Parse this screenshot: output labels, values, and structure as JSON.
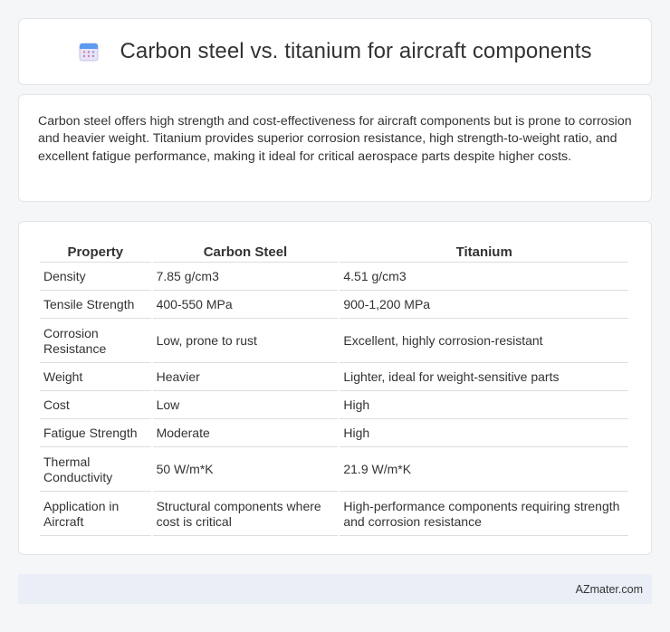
{
  "header": {
    "title": "Carbon steel vs. titanium for aircraft components",
    "icon": "calendar-icon"
  },
  "summary": {
    "text": "Carbon steel offers high strength and cost-effectiveness for aircraft components but is prone to corrosion and heavier weight. Titanium provides superior corrosion resistance, high strength-to-weight ratio, and excellent fatigue performance, making it ideal for critical aerospace parts despite higher costs."
  },
  "table": {
    "headers": [
      "Property",
      "Carbon Steel",
      "Titanium"
    ],
    "rows": [
      [
        "Density",
        "7.85 g/cm3",
        "4.51 g/cm3"
      ],
      [
        "Tensile Strength",
        "400-550 MPa",
        "900-1,200 MPa"
      ],
      [
        "Corrosion Resistance",
        "Low, prone to rust",
        "Excellent, highly corrosion-resistant"
      ],
      [
        "Weight",
        "Heavier",
        "Lighter, ideal for weight-sensitive parts"
      ],
      [
        "Cost",
        "Low",
        "High"
      ],
      [
        "Fatigue Strength",
        "Moderate",
        "High"
      ],
      [
        "Thermal Conductivity",
        "50 W/m*K",
        "21.9 W/m*K"
      ],
      [
        "Application in Aircraft",
        "Structural components where cost is critical",
        "High-performance components requiring strength and corrosion resistance"
      ]
    ]
  },
  "footer": {
    "site": "AZmater.com"
  }
}
